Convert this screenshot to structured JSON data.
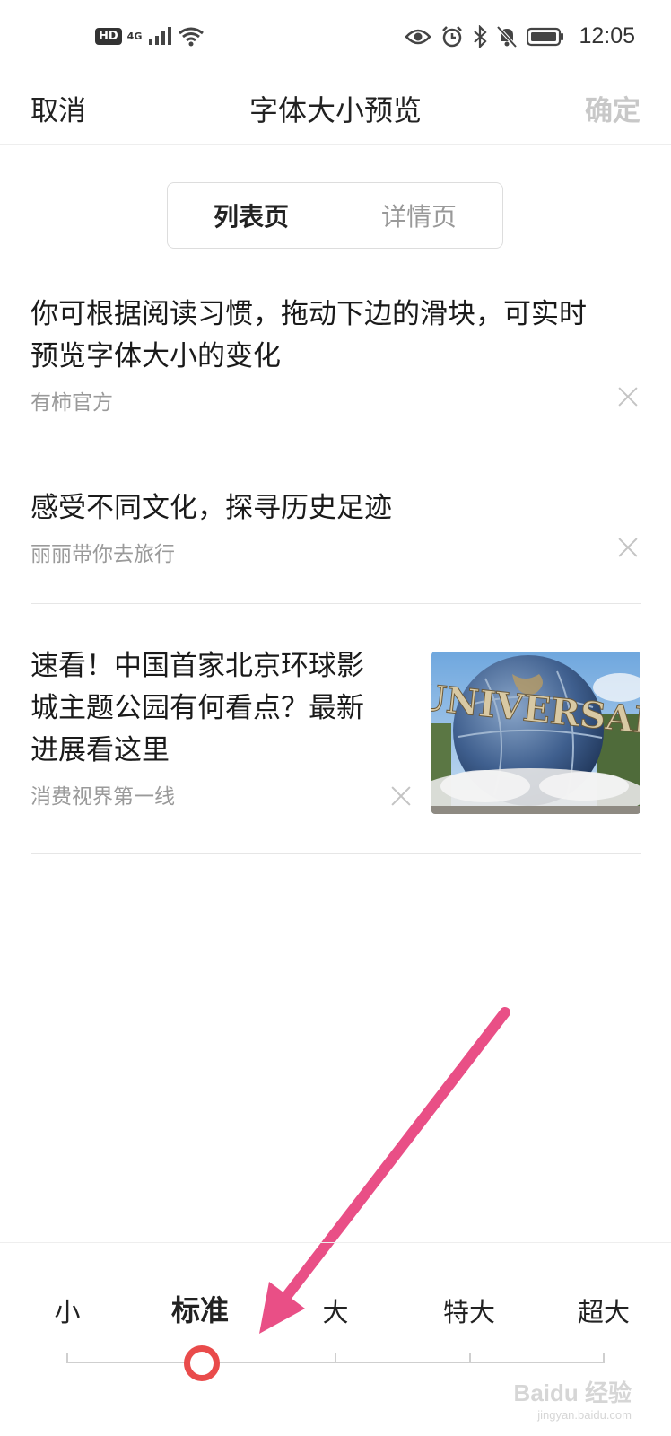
{
  "status_bar": {
    "hd_label": "HD",
    "network_label": "4G",
    "time": "12:05",
    "left_icons": [
      "signal-icon",
      "wifi-icon"
    ],
    "right_icons": [
      "eye-icon",
      "alarm-icon",
      "bluetooth-icon",
      "bell-off-icon",
      "battery-icon"
    ]
  },
  "header": {
    "cancel": "取消",
    "title": "字体大小预览",
    "confirm": "确定"
  },
  "segment": {
    "tabs": [
      {
        "label": "列表页",
        "active": true
      },
      {
        "label": "详情页",
        "active": false
      }
    ]
  },
  "news": [
    {
      "title_lines": [
        "你可根据阅读习惯，拖动下边的滑块，可实时",
        "预览字体大小的变化"
      ],
      "source": "有柿官方"
    },
    {
      "title_lines": [
        "感受不同文化，探寻历史足迹"
      ],
      "source": "丽丽带你去旅行"
    },
    {
      "title_lines": [
        "速看！中国首家北京环球影",
        "城主题公园有何看点？最新",
        "进展看这里"
      ],
      "source": "消费视界第一线",
      "thumbnail_text": "UNIVERSAL"
    }
  ],
  "font_size": {
    "labels": [
      "小",
      "标准",
      "大",
      "特大",
      "超大"
    ],
    "selected_index": 1,
    "accent_color": "#e94b4b"
  },
  "annotation": {
    "arrow_color": "#e94f86"
  },
  "watermark": {
    "main": "Baidu 经验",
    "sub": "jingyan.baidu.com"
  }
}
